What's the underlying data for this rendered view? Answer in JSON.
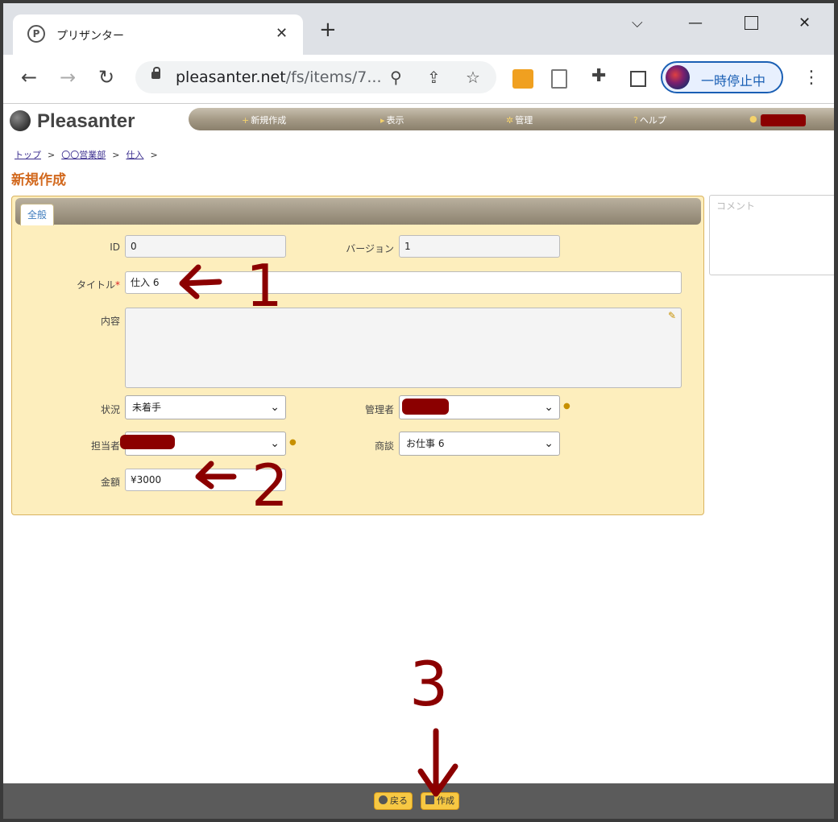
{
  "browser": {
    "tab_title": "プリザンター",
    "tab_favicon": "P",
    "url_host": "pleasanter.net",
    "url_path": "/fs/items/7...",
    "profile_label": "一時停止中"
  },
  "app": {
    "logo": "Pleasanter",
    "menu": {
      "new": "新規作成",
      "view": "表示",
      "manage": "管理",
      "help": "ヘルプ"
    },
    "breadcrumb": [
      "トップ",
      "〇〇営業部",
      "仕入"
    ],
    "page_title": "新規作成",
    "tab_general": "全般",
    "comment_placeholder": "コメント",
    "fields": {
      "id_label": "ID",
      "id_value": "0",
      "version_label": "バージョン",
      "version_value": "1",
      "title_label": "タイトル",
      "title_required": "*",
      "title_value": "仕入 6",
      "body_label": "内容",
      "status_label": "状況",
      "status_value": "未着手",
      "manager_label": "管理者",
      "owner_label": "担当者",
      "deal_label": "商談",
      "deal_value": "お仕事 6",
      "amount_label": "金額",
      "amount_value": "¥3000"
    },
    "footer": {
      "back": "戻る",
      "create": "作成"
    }
  },
  "annotations": [
    "1",
    "2",
    "3"
  ],
  "colors": {
    "accent_title": "#d2691e",
    "panel_bg": "#fdeebd",
    "annotation": "#8b0000"
  }
}
